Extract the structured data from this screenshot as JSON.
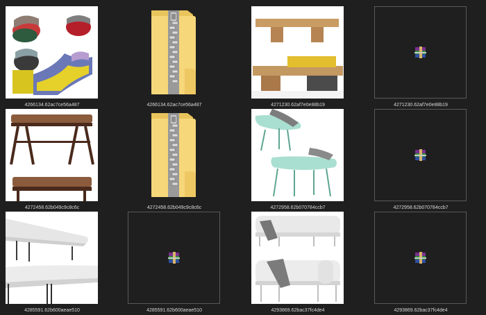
{
  "files": [
    {
      "name": "4266134.62ac7ce56a487",
      "kind": "image",
      "icon": "image-preview-bean-bag-chairs",
      "preview": "beanbags"
    },
    {
      "name": "4266134.62ac7ce56a487",
      "kind": "zip-folder",
      "icon": "zip-folder-icon"
    },
    {
      "name": "4271230.62af7e0e88b19",
      "kind": "image",
      "icon": "image-preview-wood-bench",
      "preview": "woodbench"
    },
    {
      "name": "4271230.62af7e0e88b19",
      "kind": "rar-archive",
      "icon": "winrar-archive-icon"
    },
    {
      "name": "4272458.62b049c9c8c6c",
      "kind": "image",
      "icon": "image-preview-leather-bench",
      "preview": "leatherbench"
    },
    {
      "name": "4272458.62b049c9c8c6c",
      "kind": "zip-folder",
      "icon": "zip-folder-icon"
    },
    {
      "name": "4272958.62b070784ccb7",
      "kind": "image",
      "icon": "image-preview-mint-lounge-chairs",
      "preview": "mintchairs"
    },
    {
      "name": "4272958.62b070784ccb7",
      "kind": "rar-archive",
      "icon": "winrar-archive-icon"
    },
    {
      "name": "4285591.62b600aeae510",
      "kind": "image",
      "icon": "image-preview-white-bench",
      "preview": "whitebench"
    },
    {
      "name": "4285591.62b600aeae510",
      "kind": "rar-archive",
      "icon": "winrar-archive-icon"
    },
    {
      "name": "4293869.62bac37fc4de4",
      "kind": "image",
      "icon": "image-preview-daybed",
      "preview": "daybed"
    },
    {
      "name": "4293869.62bac37fc4de4",
      "kind": "rar-archive",
      "icon": "winrar-archive-icon"
    }
  ],
  "colors": {
    "background": "#1f1f1f",
    "caption_text": "#d8d8d8",
    "tile_border": "#5a5a5a",
    "folder_yellow": "#f6d77a",
    "folder_dark_yellow": "#e8c25a"
  }
}
